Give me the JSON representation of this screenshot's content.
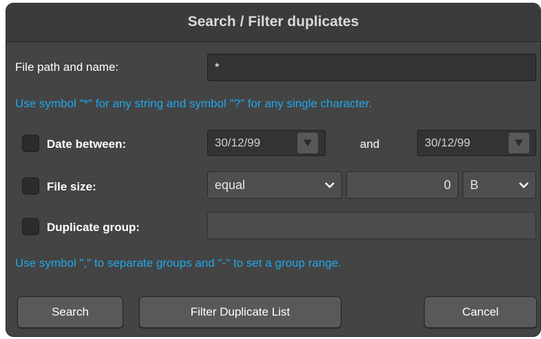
{
  "dialog": {
    "title": "Search / Filter duplicates"
  },
  "path": {
    "label": "File path and name:",
    "value": "*",
    "hint": "Use symbol \"*\" for any string and symbol \"?\" for any single character."
  },
  "date": {
    "label": "Date between:",
    "from": "30/12/99",
    "and_label": "and",
    "to": "30/12/99",
    "checked": false
  },
  "size": {
    "label": "File size:",
    "operator": "equal",
    "value": "0",
    "unit": "B",
    "checked": false
  },
  "group": {
    "label": "Duplicate group:",
    "value": "",
    "checked": false,
    "hint": "Use symbol \",\" to separate groups and \"-\" to set a group range."
  },
  "buttons": {
    "search": "Search",
    "filter": "Filter Duplicate List",
    "cancel": "Cancel"
  },
  "colors": {
    "hint": "#1fa8e8",
    "background": "#444444"
  }
}
